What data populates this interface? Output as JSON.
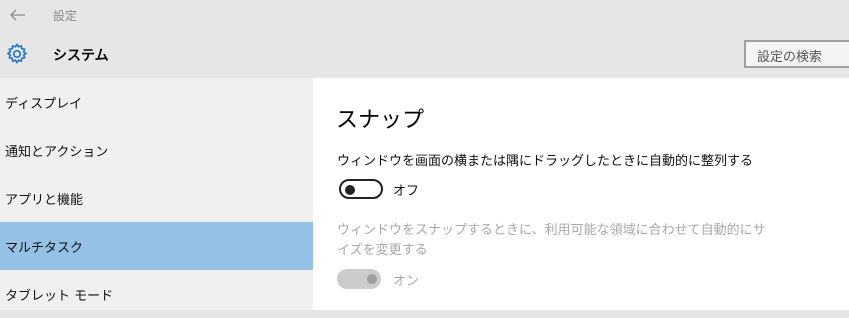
{
  "window": {
    "title": "設定"
  },
  "header": {
    "title": "システム",
    "search_placeholder": "設定の検索"
  },
  "sidebar": {
    "items": [
      {
        "label": "ディスプレイ",
        "selected": false
      },
      {
        "label": "通知とアクション",
        "selected": false
      },
      {
        "label": "アプリと機能",
        "selected": false
      },
      {
        "label": "マルチタスク",
        "selected": true
      },
      {
        "label": "タブレット モード",
        "selected": false
      }
    ]
  },
  "main": {
    "section_title": "スナップ",
    "setting1": {
      "label": "ウィンドウを画面の横または隅にドラッグしたときに自動的に整列する",
      "state": "オフ"
    },
    "setting2": {
      "label": "ウィンドウをスナップするときに、利用可能な領域に合わせて自動的にサイズを変更する",
      "state": "オン"
    }
  },
  "colors": {
    "selected": "#94c1e6",
    "accent": "#1e74c8",
    "disabled": "#a8a8a8"
  },
  "icons": {
    "back": "back-arrow-icon",
    "settings": "gear-icon"
  }
}
